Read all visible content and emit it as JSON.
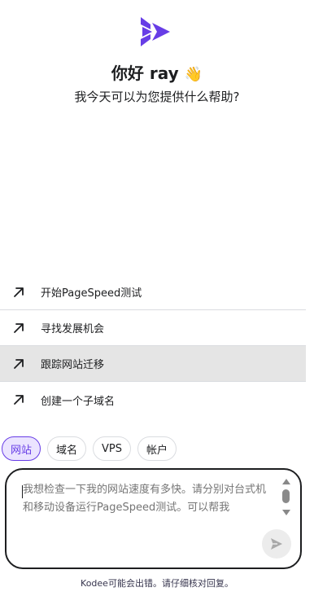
{
  "brand": {
    "logo_icon": "kodee-logo-icon",
    "accent_color": "#673de6"
  },
  "greeting": {
    "text": "你好 ray",
    "emoji": "👋"
  },
  "subtitle": "我今天可以为您提供什么帮助?",
  "suggestions": [
    {
      "label": "开始PageSpeed测试",
      "icon": "arrow-up-right-icon"
    },
    {
      "label": "寻找发展机会",
      "icon": "arrow-up-right-icon"
    },
    {
      "label": "跟踪网站迁移",
      "icon": "arrow-up-right-icon",
      "highlighted": true
    },
    {
      "label": "创建一个子域名",
      "icon": "arrow-up-right-icon"
    }
  ],
  "chips": [
    {
      "label": "网站",
      "selected": true
    },
    {
      "label": "域名"
    },
    {
      "label": "VPS"
    },
    {
      "label": "帐户"
    }
  ],
  "composer": {
    "placeholder": "我想检查一下我的网站速度有多快。请分别对台式机和移动设备运行PageSpeed测试。可以帮我",
    "send_icon": "send-icon"
  },
  "disclaimer": "Kodee可能会出错。请仔细核对回复。"
}
